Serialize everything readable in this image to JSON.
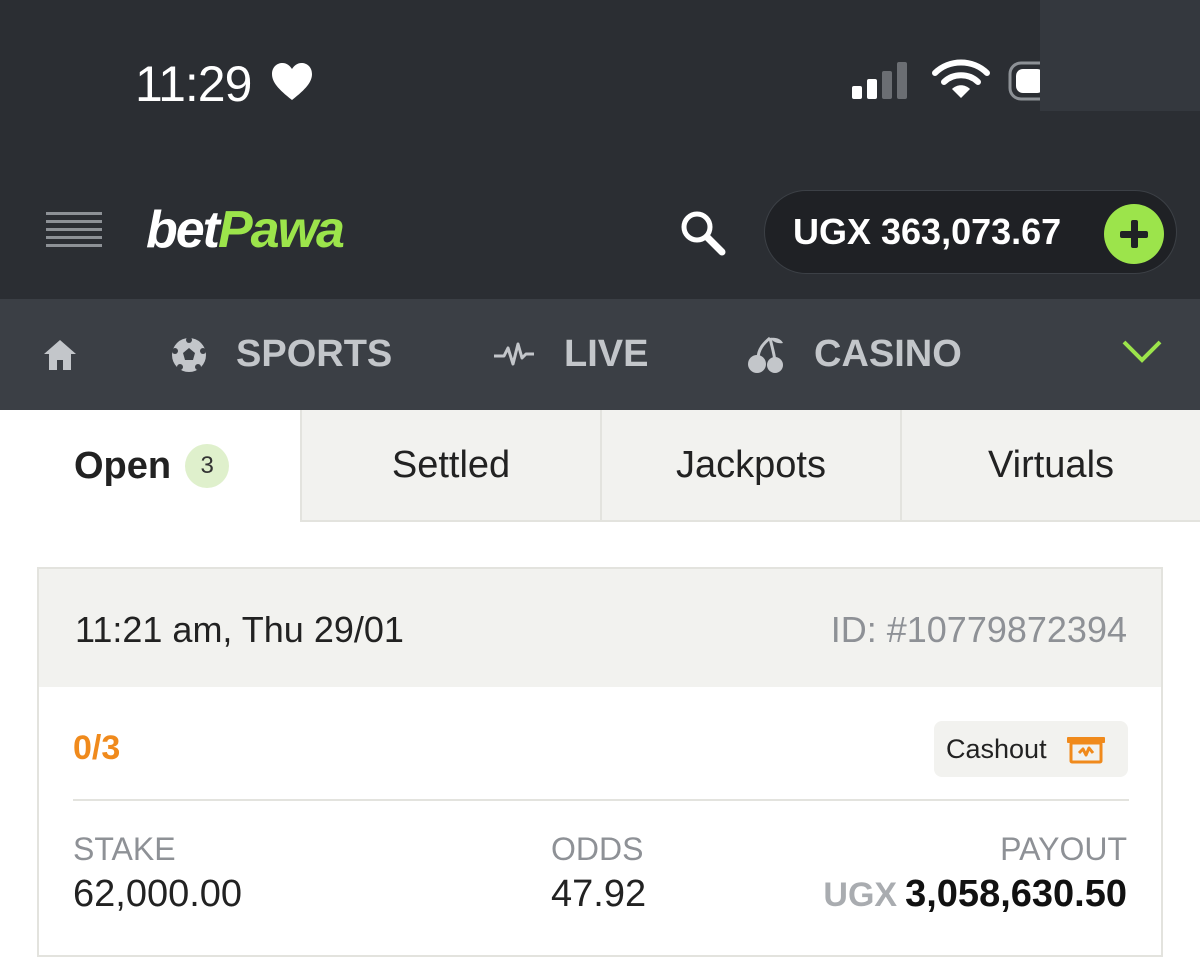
{
  "status_bar": {
    "time": "11:29"
  },
  "header": {
    "logo_part1": "bet",
    "logo_part2": "Pawa",
    "balance": "UGX 363,073.67"
  },
  "nav": {
    "items": [
      {
        "label": "SPORTS"
      },
      {
        "label": "LIVE"
      },
      {
        "label": "CASINO"
      }
    ]
  },
  "tabs": [
    {
      "label": "Open",
      "badge": "3"
    },
    {
      "label": "Settled"
    },
    {
      "label": "Jackpots"
    },
    {
      "label": "Virtuals"
    }
  ],
  "bet": {
    "datetime": "11:21 am, Thu 29/01",
    "id": "ID: #10779872394",
    "progress": "0/3",
    "cashout_label": "Cashout",
    "stake_label": "STAKE",
    "stake_value": "62,000.00",
    "odds_label": "ODDS",
    "odds_value": "47.92",
    "payout_label": "PAYOUT",
    "payout_currency": "UGX",
    "payout_value": "3,058,630.50"
  },
  "colors": {
    "brand_green": "#9ce44b",
    "header_bg": "#2b2e33",
    "nav_bg": "#3b3f45",
    "accent_orange": "#f08a1c"
  }
}
